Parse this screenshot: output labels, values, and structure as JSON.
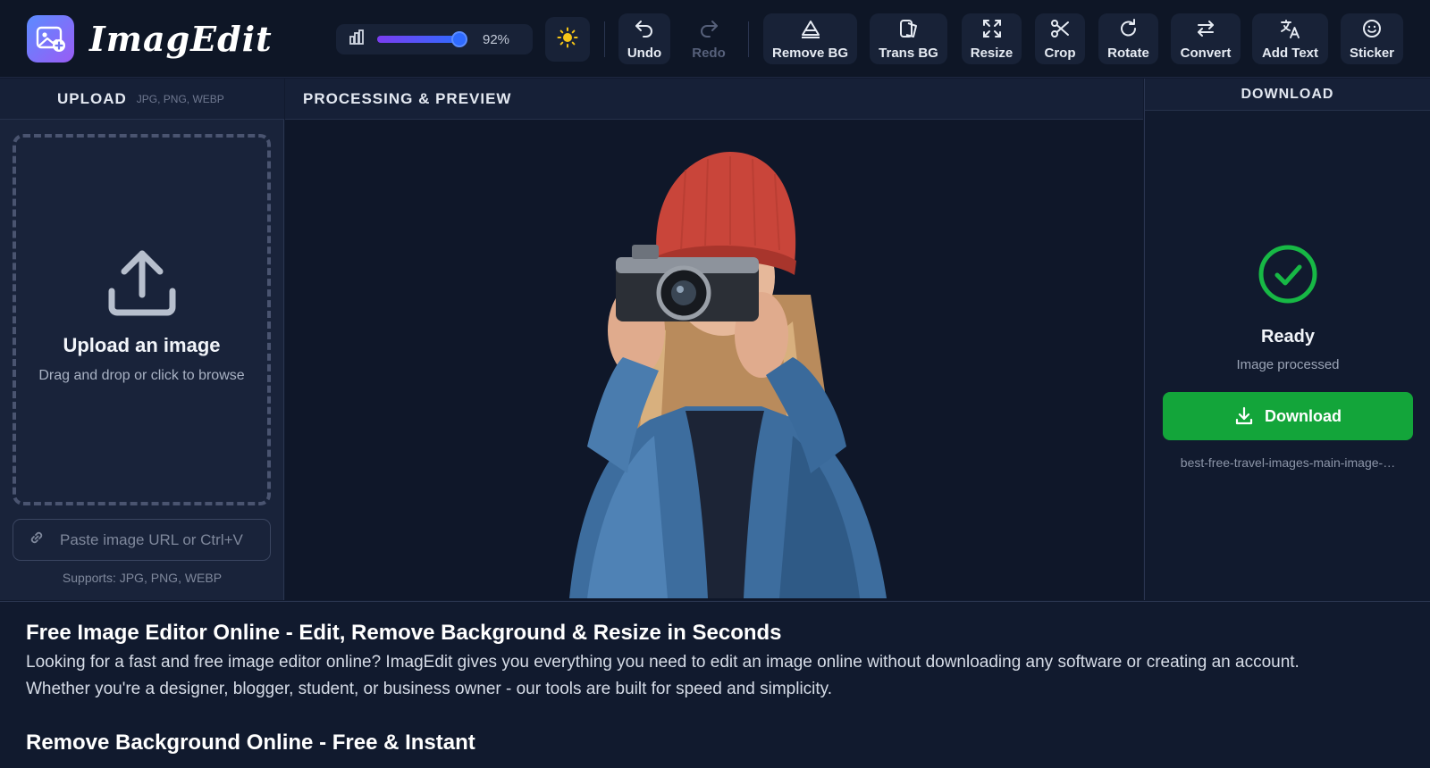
{
  "app": {
    "name": "ImagEdit"
  },
  "toolbar": {
    "zoom_value": "92%",
    "zoom_fraction": 0.92,
    "tools": [
      {
        "id": "undo",
        "label": "Undo",
        "icon": "undo-icon",
        "enabled": true
      },
      {
        "id": "redo",
        "label": "Redo",
        "icon": "redo-icon",
        "enabled": false
      },
      {
        "id": "remove-bg",
        "label": "Remove BG",
        "icon": "eraser-icon",
        "enabled": true
      },
      {
        "id": "trans-bg",
        "label": "Trans BG",
        "icon": "transparency-icon",
        "enabled": true
      },
      {
        "id": "resize",
        "label": "Resize",
        "icon": "expand-icon",
        "enabled": true
      },
      {
        "id": "crop",
        "label": "Crop",
        "icon": "scissors-icon",
        "enabled": true
      },
      {
        "id": "rotate",
        "label": "Rotate",
        "icon": "rotate-icon",
        "enabled": true
      },
      {
        "id": "convert",
        "label": "Convert",
        "icon": "swap-icon",
        "enabled": true
      },
      {
        "id": "add-text",
        "label": "Add Text",
        "icon": "translate-icon",
        "enabled": true
      },
      {
        "id": "sticker",
        "label": "Sticker",
        "icon": "smiley-icon",
        "enabled": true
      }
    ]
  },
  "upload": {
    "heading": "UPLOAD",
    "formats": "JPG, PNG, WEBP",
    "drop_title": "Upload an image",
    "drop_subtitle": "Drag and drop or click to browse",
    "url_placeholder": "Paste image URL or Ctrl+V",
    "supports": "Supports: JPG, PNG, WEBP"
  },
  "preview": {
    "heading": "PROCESSING & PREVIEW"
  },
  "download": {
    "heading": "DOWNLOAD",
    "status_title": "Ready",
    "status_subtitle": "Image processed",
    "button_label": "Download",
    "filename": "best-free-travel-images-main-image-…"
  },
  "article": {
    "sections": [
      {
        "heading": "Free Image Editor Online - Edit, Remove Background & Resize in Seconds",
        "body_lines": [
          "Looking for a fast and free image editor online? ImagEdit gives you everything you need to edit an image online without downloading any software or creating an account.",
          "Whether you're a designer, blogger, student, or business owner - our tools are built for speed and simplicity."
        ]
      },
      {
        "heading": "Remove Background Online - Free & Instant",
        "body_lines": []
      }
    ]
  },
  "colors": {
    "accent_green": "#13a53a",
    "accent_purple": "#7b3df0",
    "accent_blue": "#2f6bff",
    "sun_yellow": "#f5c518"
  }
}
